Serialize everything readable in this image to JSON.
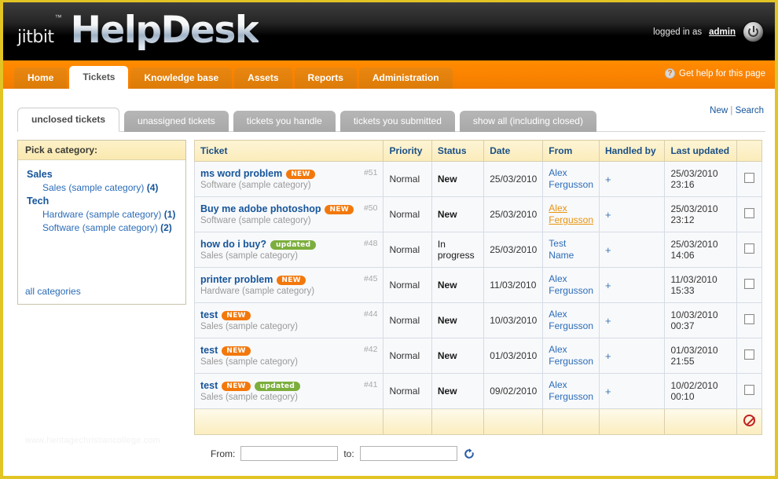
{
  "brand": {
    "prefix": "jitbit",
    "tm": "™",
    "name": "HelpDesk"
  },
  "header": {
    "logged_in_text": "logged in as",
    "username": "admin",
    "power_icon": "power-icon"
  },
  "nav": {
    "items": [
      {
        "label": "Home",
        "active": false
      },
      {
        "label": "Tickets",
        "active": true
      },
      {
        "label": "Knowledge base",
        "active": false
      },
      {
        "label": "Assets",
        "active": false
      },
      {
        "label": "Reports",
        "active": false
      },
      {
        "label": "Administration",
        "active": false
      }
    ],
    "help_label": "Get help for this page",
    "help_icon": "question-mark-icon"
  },
  "toplinks": {
    "new": "New",
    "separator": "|",
    "search": "Search"
  },
  "subtabs": [
    {
      "label": "unclosed tickets",
      "active": true
    },
    {
      "label": "unassigned tickets",
      "active": false
    },
    {
      "label": "tickets you handle",
      "active": false
    },
    {
      "label": "tickets you submitted",
      "active": false
    },
    {
      "label": "show all (including closed)",
      "active": false
    }
  ],
  "sidebar": {
    "title": "Pick a category:",
    "groups": [
      {
        "name": "Sales",
        "items": [
          {
            "label": "Sales (sample category)",
            "count": "(4)"
          }
        ]
      },
      {
        "name": "Tech",
        "items": [
          {
            "label": "Hardware (sample category)",
            "count": "(1)"
          },
          {
            "label": "Software (sample category)",
            "count": "(2)"
          }
        ]
      }
    ],
    "all_categories": "all categories"
  },
  "table": {
    "columns": [
      "Ticket",
      "Priority",
      "Status",
      "Date",
      "From",
      "Handled by",
      "Last updated",
      ""
    ],
    "rows": [
      {
        "title": "ms word problem",
        "badges": [
          "NEW"
        ],
        "number": "#51",
        "category": "Software (sample category)",
        "priority": "Normal",
        "status": "New",
        "status_bold": true,
        "date": "25/03/2010",
        "from": "Alex Fergusson",
        "from_hovered": false,
        "handled_by": "+",
        "last_updated_date": "25/03/2010",
        "last_updated_time": "23:16"
      },
      {
        "title": "Buy me adobe photoshop",
        "badges": [
          "NEW"
        ],
        "number": "#50",
        "category": "Software (sample category)",
        "priority": "Normal",
        "status": "New",
        "status_bold": true,
        "date": "25/03/2010",
        "from": "Alex Fergusson",
        "from_hovered": true,
        "handled_by": "+",
        "last_updated_date": "25/03/2010",
        "last_updated_time": "23:12"
      },
      {
        "title": "how do i buy?",
        "badges": [
          "updated"
        ],
        "number": "#48",
        "category": "Sales (sample category)",
        "priority": "Normal",
        "status": "In progress",
        "status_bold": false,
        "date": "25/03/2010",
        "from": "Test Name",
        "from_hovered": false,
        "handled_by": "+",
        "last_updated_date": "25/03/2010",
        "last_updated_time": "14:06"
      },
      {
        "title": "printer problem",
        "badges": [
          "NEW"
        ],
        "number": "#45",
        "category": "Hardware (sample category)",
        "priority": "Normal",
        "status": "New",
        "status_bold": true,
        "date": "11/03/2010",
        "from": "Alex Fergusson",
        "from_hovered": false,
        "handled_by": "+",
        "last_updated_date": "11/03/2010",
        "last_updated_time": "15:33"
      },
      {
        "title": "test",
        "badges": [
          "NEW"
        ],
        "number": "#44",
        "category": "Sales (sample category)",
        "priority": "Normal",
        "status": "New",
        "status_bold": true,
        "date": "10/03/2010",
        "from": "Alex Fergusson",
        "from_hovered": false,
        "handled_by": "+",
        "last_updated_date": "10/03/2010",
        "last_updated_time": "00:37"
      },
      {
        "title": "test",
        "badges": [
          "NEW"
        ],
        "number": "#42",
        "category": "Sales (sample category)",
        "priority": "Normal",
        "status": "New",
        "status_bold": true,
        "date": "01/03/2010",
        "from": "Alex Fergusson",
        "from_hovered": false,
        "handled_by": "+",
        "last_updated_date": "01/03/2010",
        "last_updated_time": "21:55"
      },
      {
        "title": "test",
        "badges": [
          "NEW",
          "updated"
        ],
        "number": "#41",
        "category": "Sales (sample category)",
        "priority": "Normal",
        "status": "New",
        "status_bold": true,
        "date": "09/02/2010",
        "from": "Alex Fergusson",
        "from_hovered": false,
        "handled_by": "+",
        "last_updated_date": "10/02/2010",
        "last_updated_time": "00:10"
      }
    ],
    "footer_delete_icon": "delete-ban-icon"
  },
  "bottom_form": {
    "from_label": "From:",
    "from_value": "",
    "to_label": "to:",
    "to_value": "",
    "refresh_icon": "refresh-icon"
  },
  "watermark": "www.heritagechristiancollege.com",
  "colors": {
    "page_border": "#e2c424",
    "nav_orange": "#fa8200",
    "tab_orange": "#dd7b08",
    "link_blue": "#16559a",
    "badge_new": "#f3780c",
    "badge_updated": "#7cae3d",
    "priority_green": "#2e7d32",
    "header_yellow": "#fbecba",
    "hover_orange": "#e8930d"
  }
}
